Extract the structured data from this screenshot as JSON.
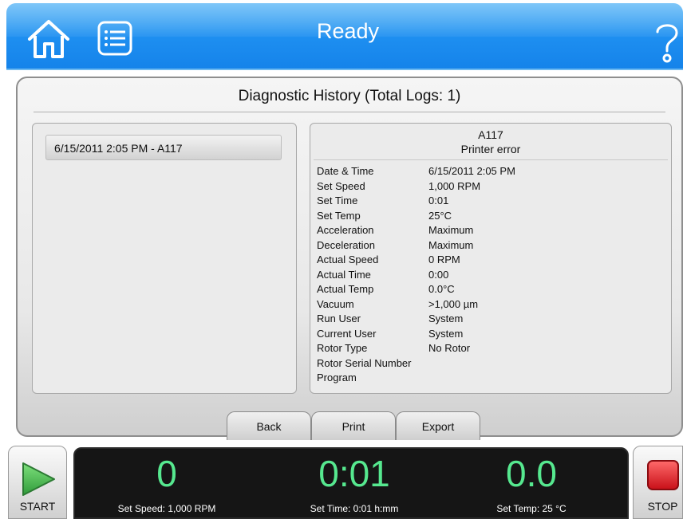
{
  "header": {
    "title": "Ready"
  },
  "panel": {
    "title": "Diagnostic History (Total Logs: 1)",
    "log_items": [
      "6/15/2011 2:05 PM - A117"
    ],
    "detail": {
      "code": "A117",
      "message": "Printer error",
      "fields": [
        {
          "label": "Date & Time",
          "value": "6/15/2011 2:05 PM"
        },
        {
          "label": "Set Speed",
          "value": "1,000 RPM"
        },
        {
          "label": "Set Time",
          "value": "0:01"
        },
        {
          "label": "Set Temp",
          "value": "25°C"
        },
        {
          "label": "Acceleration",
          "value": "Maximum"
        },
        {
          "label": "Deceleration",
          "value": "Maximum"
        },
        {
          "label": "Actual Speed",
          "value": "0 RPM"
        },
        {
          "label": "Actual Time",
          "value": "0:00"
        },
        {
          "label": "Actual Temp",
          "value": "0.0°C"
        },
        {
          "label": "Vacuum",
          "value": ">1,000 µm"
        },
        {
          "label": "Run User",
          "value": "System"
        },
        {
          "label": "Current User",
          "value": "System"
        },
        {
          "label": "Rotor Type",
          "value": "No Rotor"
        },
        {
          "label": "Rotor Serial Number",
          "value": ""
        },
        {
          "label": "Program",
          "value": ""
        }
      ]
    },
    "tabs": [
      "Back",
      "Print",
      "Export"
    ]
  },
  "controls": {
    "start_label": "START",
    "stop_label": "STOP"
  },
  "status": {
    "speed": {
      "value": "0",
      "sub": "Set Speed: 1,000 RPM"
    },
    "time": {
      "value": "0:01",
      "sub": "Set Time: 0:01 h:mm"
    },
    "temp": {
      "value": "0.0",
      "sub": "Set Temp: 25 °C"
    }
  },
  "colors": {
    "header_blue": "#1d8ef0",
    "readout_green": "#56e88f",
    "stop_red": "#e0141e",
    "start_green": "#3fb34a"
  }
}
